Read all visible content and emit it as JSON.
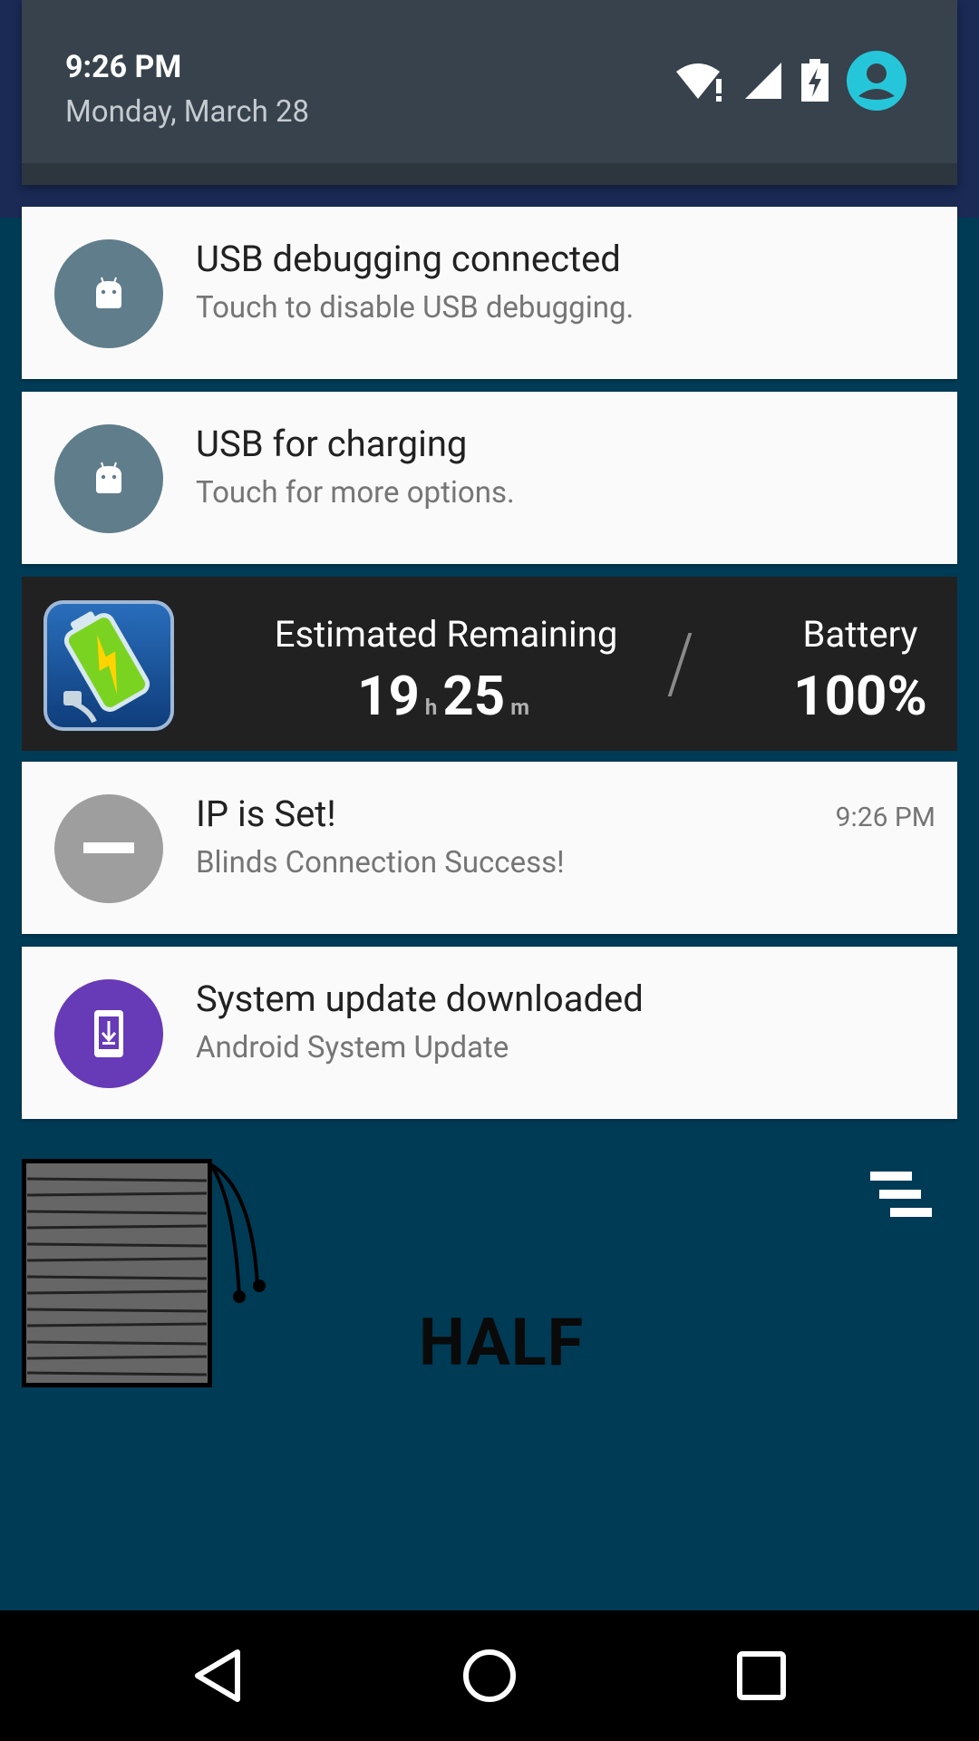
{
  "status": {
    "time": "9:26 PM",
    "date": "Monday, March 28"
  },
  "notifications": [
    {
      "title": "USB debugging connected",
      "text": "Touch to disable USB debugging.",
      "icon": "android-icon",
      "color": "#607d8b"
    },
    {
      "title": "USB for charging",
      "text": "Touch for more options.",
      "icon": "android-icon",
      "color": "#607d8b"
    },
    {
      "title": "IP is Set!",
      "text": "Blinds Connection Success!",
      "time": "9:26 PM",
      "icon": "minus-icon",
      "color": "#9e9e9e"
    },
    {
      "title": "System update downloaded",
      "text": "Android System Update",
      "icon": "system-update-icon",
      "color": "#673ab7"
    }
  ],
  "battery_widget": {
    "estimated_label": "Estimated Remaining",
    "hours": "19",
    "hours_unit": "h",
    "minutes": "25",
    "minutes_unit": "m",
    "battery_label": "Battery",
    "battery_value": "100%"
  },
  "app": {
    "mode_label": "HALF"
  },
  "colors": {
    "app_background": "#003b56",
    "header": "#37424c",
    "avatar": "#26c6da"
  }
}
